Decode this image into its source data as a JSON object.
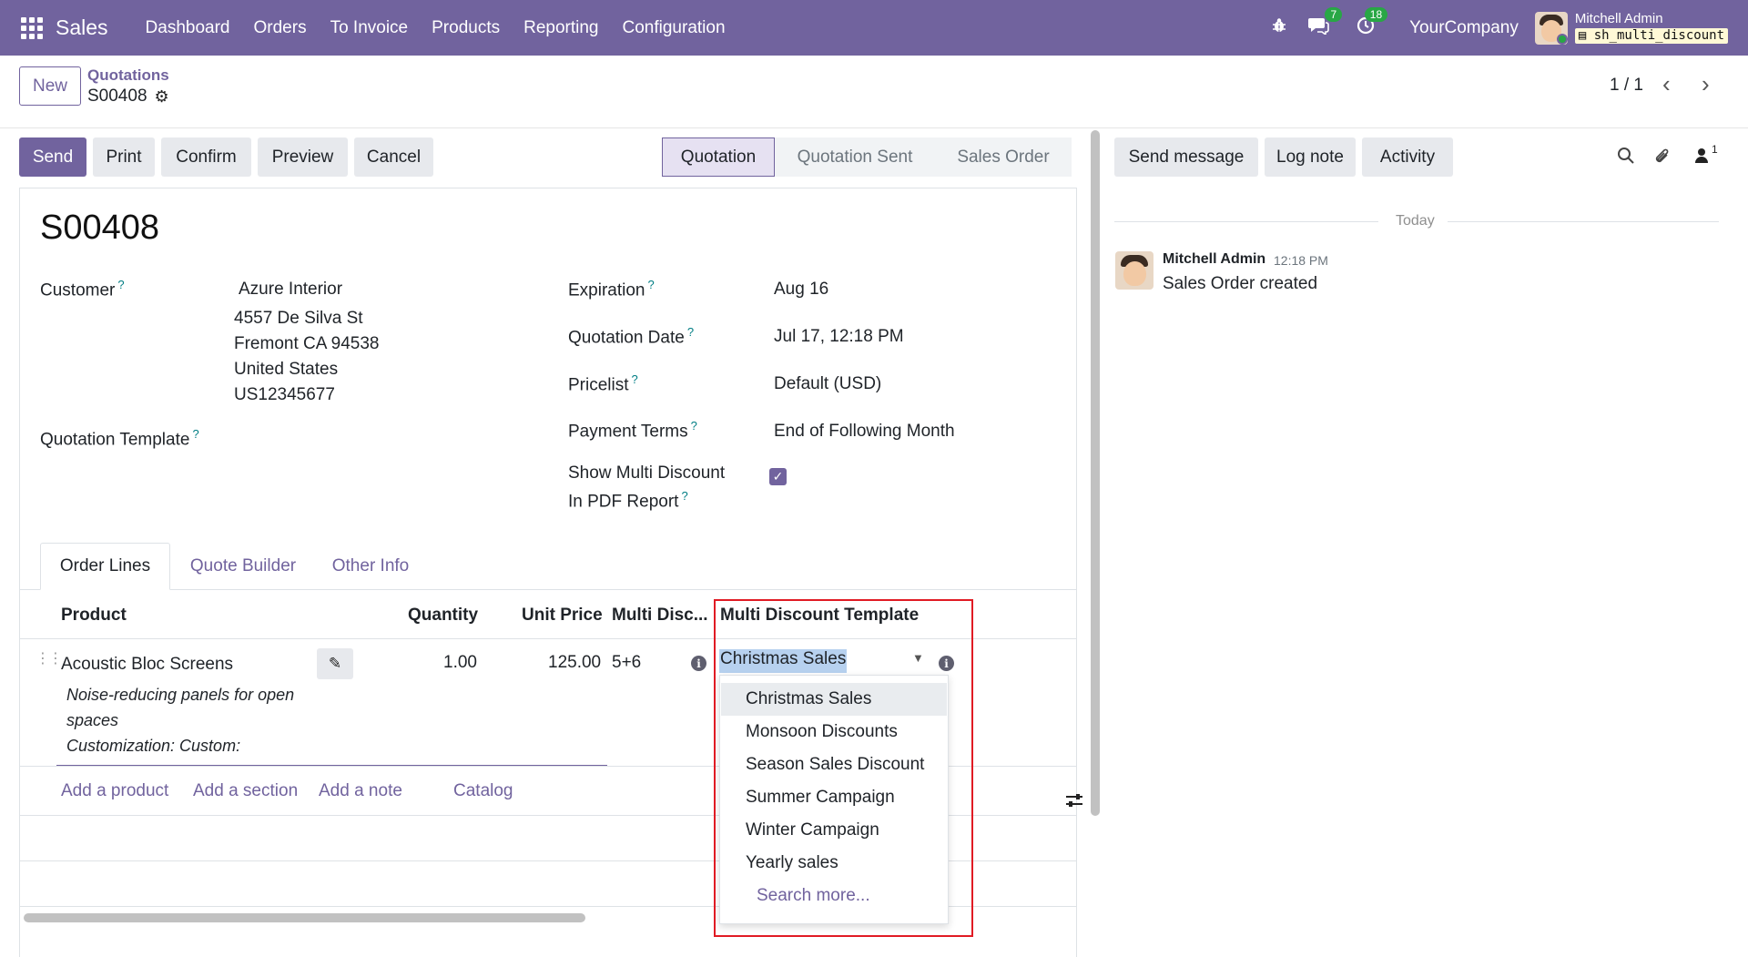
{
  "navbar": {
    "app_name": "Sales",
    "menu": [
      "Dashboard",
      "Orders",
      "To Invoice",
      "Products",
      "Reporting",
      "Configuration"
    ],
    "messages_count": "7",
    "activities_count": "18",
    "company": "YourCompany",
    "user_name": "Mitchell Admin",
    "database": "sh_multi_discount"
  },
  "control": {
    "new_label": "New",
    "breadcrumb_parent": "Quotations",
    "breadcrumb_current": "S00408",
    "pager": "1 / 1"
  },
  "actions": {
    "send": "Send",
    "print": "Print",
    "confirm": "Confirm",
    "preview": "Preview",
    "cancel": "Cancel"
  },
  "statusbar": [
    "Quotation",
    "Quotation Sent",
    "Sales Order"
  ],
  "active_status": "Quotation",
  "form": {
    "title": "S00408",
    "customer_label": "Customer",
    "customer_name": "Azure Interior",
    "address_1": "4557 De Silva St",
    "address_2": "Fremont CA 94538",
    "address_3": "United States",
    "address_4": "US12345677",
    "template_label": "Quotation Template",
    "expiration_label": "Expiration",
    "expiration_value": "Aug 16",
    "quotation_date_label": "Quotation Date",
    "quotation_date_value": "Jul 17, 12:18 PM",
    "pricelist_label": "Pricelist",
    "pricelist_value": "Default (USD)",
    "payment_terms_label": "Payment Terms",
    "payment_terms_value": "End of Following Month",
    "multi_discount_label_1": "Show Multi Discount",
    "multi_discount_label_2": "In PDF Report",
    "multi_discount_checked": true,
    "help_mark": "?"
  },
  "tabs": [
    "Order Lines",
    "Quote Builder",
    "Other Info"
  ],
  "table": {
    "headers": {
      "product": "Product",
      "quantity": "Quantity",
      "unit_price": "Unit Price",
      "multi_disc": "Multi Disc...",
      "template": "Multi Discount Template"
    },
    "row": {
      "product": "Acoustic Bloc Screens",
      "desc_1": "Noise-reducing panels for open",
      "desc_2": "spaces",
      "desc_3": "Customization: Custom:",
      "quantity": "1.00",
      "unit_price": "125.00",
      "multi_disc": "5+6",
      "template": "Christmas Sales"
    },
    "add_product": "Add a product",
    "add_section": "Add a section",
    "add_note": "Add a note",
    "catalog": "Catalog"
  },
  "dropdown": {
    "options": [
      "Christmas Sales",
      "Monsoon Discounts",
      "Season Sales Discount",
      "Summer Campaign",
      "Winter Campaign",
      "Yearly sales"
    ],
    "search_more": "Search more..."
  },
  "chatter": {
    "send_message": "Send message",
    "log_note": "Log note",
    "activity": "Activity",
    "followers": "1",
    "today": "Today",
    "author": "Mitchell Admin",
    "time": "12:18 PM",
    "body": "Sales Order created"
  },
  "colors": {
    "brand": "#71639e",
    "highlight": "#e01b24",
    "badge": "#28a745"
  }
}
